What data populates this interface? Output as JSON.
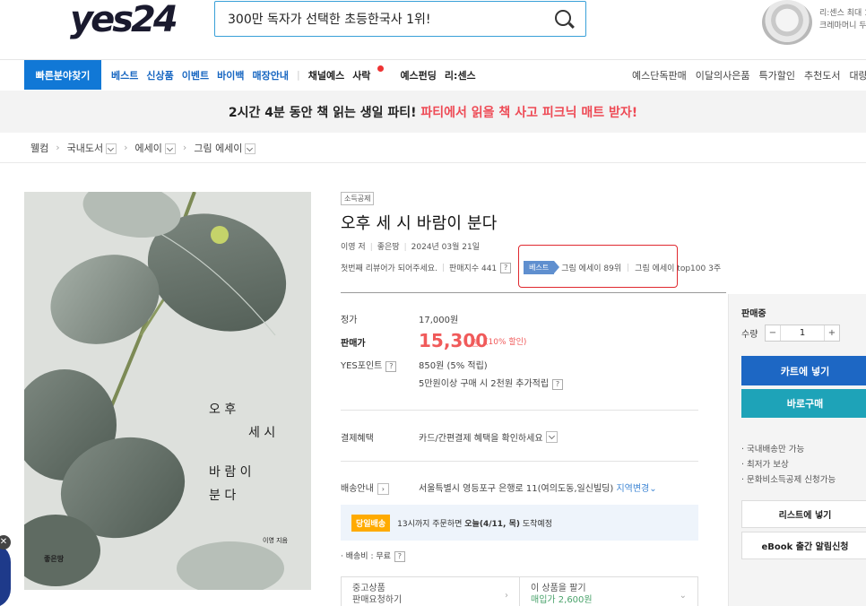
{
  "header": {
    "logo": "yes24",
    "search_value": "300만 독자가 선택한 초등한국사 1위!",
    "ad_text": [
      "리:센스 최대 1",
      "크레마머니 두"
    ]
  },
  "nav": {
    "quick_button": "빠른분야찾기",
    "items_blue": [
      "베스트",
      "신상품",
      "이벤트",
      "바이백",
      "매장안내"
    ],
    "items_dark": [
      "채널예스",
      "사락",
      "예스펀딩",
      "리:센스"
    ],
    "items_right": [
      "예스단독판매",
      "이달의사은품",
      "특가할인",
      "추천도서",
      "대량구"
    ]
  },
  "banner": {
    "black_text": "2시간 4분 동안 책 읽는 생일 파티!",
    "red_text": "파티에서 읽을 책 사고 피크닉 매트 받자!"
  },
  "breadcrumb": [
    "웰컴",
    "국내도서",
    "에세이",
    "그림 에세이"
  ],
  "cover": {
    "title_lines": [
      "오 후",
      "세 시",
      "바 람 이",
      "분 다"
    ],
    "author": "이영 지음",
    "publisher": "좋은땅"
  },
  "product": {
    "tag": "소득공제",
    "title": "오후 세 시 바람이 분다",
    "author": "이영 저",
    "publisher": "좋은땅",
    "date": "2024년 03월 21일",
    "review_prompt": "첫번째 리뷰어가 되어주세요.",
    "sales_index": "판매지수 441",
    "best_label": "베스트",
    "rank_1": "그림 에세이 89위",
    "rank_2_prefix": "그림",
    "rank_2": "에세이 top100 3주",
    "question_mark": "?",
    "list_price_label": "정가",
    "list_price": "17,000원",
    "sale_label": "판매가",
    "sale_price": "15,300",
    "sale_unit": "원",
    "discount": "(10% 할인)",
    "points_label": "YES포인트",
    "points": "850원 (5% 적립)",
    "points_extra": "5만원이상 구매 시 2천원 추가적립",
    "payment_label": "결제혜택",
    "payment_text": "카드/간편결제 혜택을 확인하세요",
    "shipping_label": "배송안내",
    "shipping_address": "서울특별시 영등포구 은행로 11(여의도동,일신빌딩)",
    "change_location": "지역변경",
    "today_badge": "당일배송",
    "today_text_prefix": "13시까지 주문하면",
    "today_text_bold": "오늘(4/11, 목)",
    "today_text_suffix": "도착예정",
    "shipping_fee": "배송비 : 무료",
    "used_line1": "중고상품",
    "used_line2": "판매요청하기",
    "sell_line1": "이 상품을 팔기",
    "sell_line2": "매입가 2,600원"
  },
  "panel": {
    "status": "판매중",
    "qty_label": "수량",
    "qty_value": "1",
    "minus": "−",
    "plus": "+",
    "cart_button": "카트에 넣기",
    "buy_button": "바로구매",
    "benefits": [
      "· 국내배송만 가능",
      "· 최저가 보상",
      "· 문화비소득공제 신청가능"
    ],
    "list_button": "리스트에 넣기",
    "ebook_button": "eBook 출간 알림신청"
  }
}
